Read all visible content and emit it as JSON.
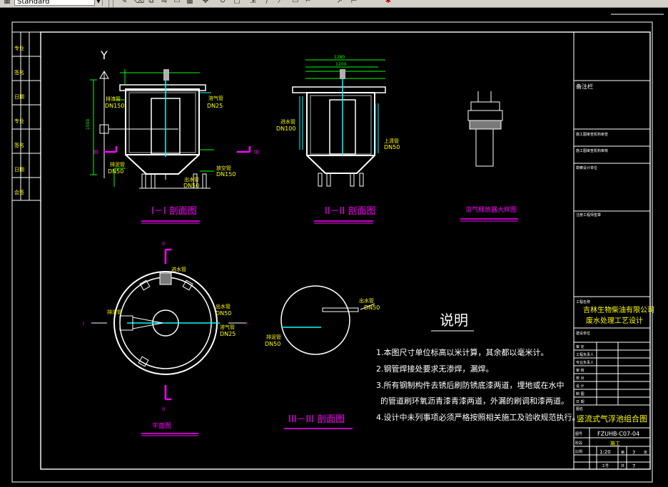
{
  "toolbar": {
    "style_combo_value": "Standard",
    "icons": [
      "layer-icon",
      "pencil-icon",
      "erase-icon",
      "copy-icon",
      "mirror-icon",
      "offset-icon",
      "array-icon",
      "move-icon",
      "rotate-icon",
      "scale-icon",
      "stretch-icon",
      "trim-icon",
      "extend-icon",
      "break-icon",
      "chamfer-icon",
      "fillet-icon",
      "explode-icon"
    ]
  },
  "colors": {
    "background": "#000000",
    "frame": "#ffffff",
    "geometry": "#00ff00",
    "dimensions": "#00ff00",
    "annotations": "#ffff00",
    "section_marks": "#ff00ff",
    "pipes": "#00ffff",
    "labels": "#ffff00"
  },
  "drawing": {
    "section_views": {
      "section_1_title": "I－I 剖面图",
      "section_2_title": "II－II 剖面图",
      "section_3_title": "III－III  剖面图",
      "plan_title": "平面图",
      "detail_title": "溶气释放器大样图",
      "y_axis_label": "Y"
    },
    "section_1_labels": {
      "inlet": "排渣管",
      "inlet_size": "DN150",
      "air_pipe": "溶气管",
      "air_pipe_size": "DN25",
      "outlet": "出水管",
      "outlet_size": "DN50",
      "sludge": "排泥管",
      "sludge_size": "DN50",
      "drain": "放空管",
      "drain_size": "DN150",
      "mark_left": "III",
      "mark_right": "III"
    },
    "section_2_labels": {
      "inflow": "进水管",
      "inflow_size": "DN100",
      "upper": "上清管",
      "upper_size": "DN50",
      "dim_top_1": "1280",
      "dim_top_2": "1200"
    },
    "plan_labels": {
      "mark_top": "II",
      "mark_bottom": "II",
      "mark_left": "I",
      "mark_right": "I",
      "water_in": "进水管",
      "slag": "排渣管",
      "outlet": "出水管",
      "outlet_size": "DN50",
      "air": "溶气管",
      "air_size": "DN25"
    },
    "section_3_labels": {
      "outlet": "出水管",
      "outlet_size": "DN50",
      "drain": "排泥管",
      "drain_size": "DN50"
    }
  },
  "notes": {
    "heading": "说明",
    "items": [
      "1.本图尺寸单位标高以米计算，其余都以毫米计。",
      "2.钢管焊接处要求无渗焊，漏焊。",
      "3.所有钢制构件去锈后刷防锈底漆两道，埋地或在水中",
      "的管道刷环氧沥青漆青漆两道，外漏的刷调和漆两道。",
      "4.设计中未列事项必须严格按照相关施工及验收规范执行。"
    ]
  },
  "title_block": {
    "remarks": "备注栏",
    "rows_top": [
      "施工图审查机构审查",
      "施工图审查机构审核",
      "勘察设计单位",
      "注册工程师签章"
    ],
    "company_label": "工程名称",
    "company": "吉林生物柴油有限公司",
    "project": "废水处理工艺设计",
    "design_unit": "建设单位",
    "roles": [
      "审  定",
      "工程负责人",
      "专业负责人",
      "审  核",
      "校  对",
      "设  计",
      "制  图",
      "日  期"
    ],
    "drawing_name_label": "图名",
    "drawing_name": "竖流式气浮池组合图",
    "drawing_code_label": "图号",
    "drawing_code": "FZUHB-C07-04",
    "stage_label": "阶段",
    "stage": "施工",
    "scale_label": "比例",
    "scale_value": "1:20",
    "sheet_label": "第",
    "sheet_no": "7",
    "sheet_unit": "张",
    "total_label": "共",
    "total_no": "7",
    "work_label": "工号"
  },
  "left_strip": {
    "cells": [
      "专业",
      "签名",
      "日期",
      "专业",
      "签名",
      "日期",
      "会签"
    ]
  }
}
